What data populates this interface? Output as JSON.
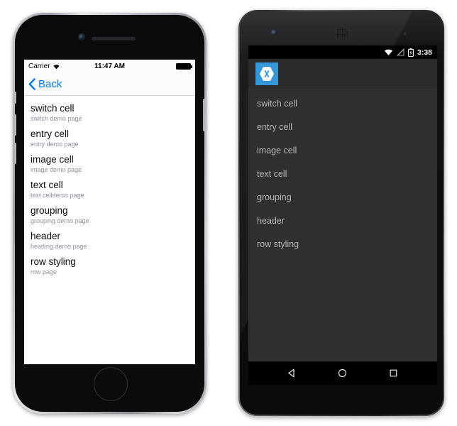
{
  "ios": {
    "status": {
      "carrier": "Carrier",
      "wifi_icon": "wifi-icon",
      "time": "11:47 AM",
      "battery_icon": "battery-full-icon"
    },
    "nav": {
      "back_label": "Back",
      "back_icon": "chevron-left-icon"
    },
    "list": [
      {
        "title": "switch cell",
        "subtitle": "switch demo page"
      },
      {
        "title": "entry cell",
        "subtitle": "entry demo page"
      },
      {
        "title": "image cell",
        "subtitle": "image demo page"
      },
      {
        "title": "text cell",
        "subtitle": "text celldemo page"
      },
      {
        "title": "grouping",
        "subtitle": "grouping demo page"
      },
      {
        "title": "header",
        "subtitle": "heading demo page"
      },
      {
        "title": "row styling",
        "subtitle": "row page"
      }
    ],
    "colors": {
      "accent": "#007aff",
      "title": "#0a0a0a",
      "subtitle": "#8c8fa3",
      "bar": "#fbfbfb"
    }
  },
  "android": {
    "status": {
      "wifi_icon": "wifi-icon",
      "signal_icon": "signal-no-service-icon",
      "battery_icon": "battery-charging-icon",
      "time": "3:38"
    },
    "appbar": {
      "logo_icon": "xamarin-logo-icon",
      "logo_letter": "X"
    },
    "list": [
      {
        "title": "switch cell"
      },
      {
        "title": "entry cell"
      },
      {
        "title": "image cell"
      },
      {
        "title": "text cell"
      },
      {
        "title": "grouping"
      },
      {
        "title": "header"
      },
      {
        "title": "row styling"
      }
    ],
    "navbar": [
      {
        "icon": "back-triangle-icon"
      },
      {
        "icon": "home-circle-icon"
      },
      {
        "icon": "recents-square-icon"
      }
    ],
    "colors": {
      "brand": "#3498db",
      "appbar": "#2b2b2b",
      "list_bg": "#303030",
      "text": "#b6b6b6"
    }
  }
}
